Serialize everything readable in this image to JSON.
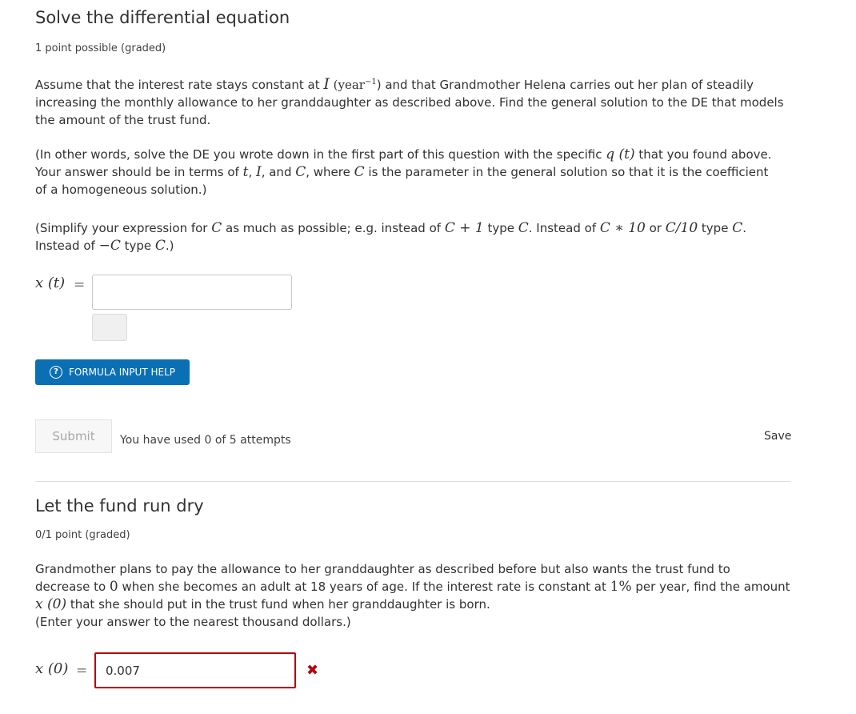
{
  "problem1": {
    "title": "Solve the differential equation",
    "points": "1 point possible (graded)",
    "para1": {
      "a": "Assume that the interest rate stays constant at ",
      "I": "I",
      "b": " (year",
      "sup": "−1",
      "c": ") and that Grandmother Helena carries out her plan of steadily",
      "line2": "increasing the monthly allowance to her granddaughter as described above. Find the general solution to the DE that models",
      "line3": "the amount of the trust fund."
    },
    "para2": {
      "a": "(In other words, solve the DE you wrote down in the first part of this question with the specific ",
      "q": "q (t)",
      "b": " that you found above.",
      "l2a": "Your answer should be in terms of ",
      "t": "t",
      "l2b": ", ",
      "I": "I",
      "l2c": ", and ",
      "C1": "C",
      "l2d": ", where ",
      "C2": "C",
      "l2e": " is the parameter in the general solution so that it is the coefficient",
      "line3": "of a homogeneous solution.)"
    },
    "para3": {
      "a": "(Simplify your expression for ",
      "C1": "C",
      "b": " as much as possible; e.g. instead of ",
      "C1p1": "C + 1",
      "c": " type ",
      "C2": "C",
      "d": ". Instead of ",
      "Cx10": "C ∗ 10",
      "e": " or ",
      "Cd10": "C/10",
      "f": " type ",
      "C3": "C",
      "g": ".",
      "l2a": "Instead of ",
      "negC": "−C",
      "l2b": " type ",
      "C4": "C",
      "l2c": ".)"
    },
    "input_label": "x (t)",
    "equals": "=",
    "input_value": "",
    "help_button": "FORMULA INPUT HELP",
    "help_icon": "?",
    "submit_label": "Submit",
    "attempts": "You have used 0 of 5 attempts",
    "save_label": "Save"
  },
  "problem2": {
    "title": "Let the fund run dry",
    "points": "0/1 point (graded)",
    "para": {
      "line1": "Grandmother plans to pay the allowance to her granddaughter as described before but also wants the trust fund to",
      "l2a": "decrease to ",
      "zero": "0",
      "l2b": " when she becomes an adult at 18 years of age. If the interest rate is constant at ",
      "pct": "1%",
      "l2c": " per year, find the amount",
      "x0": "x (0)",
      "l3": " that she should put in the trust fund when her granddaughter is born.",
      "line4": "(Enter your answer to the nearest thousand dollars.)"
    },
    "input_label": "x (0)",
    "equals": "=",
    "input_value": "0.007",
    "status_icon": "incorrect-icon",
    "status_glyph": "✖"
  },
  "colors": {
    "help_button_bg": "#0b6fb4",
    "incorrect": "#b20610"
  }
}
